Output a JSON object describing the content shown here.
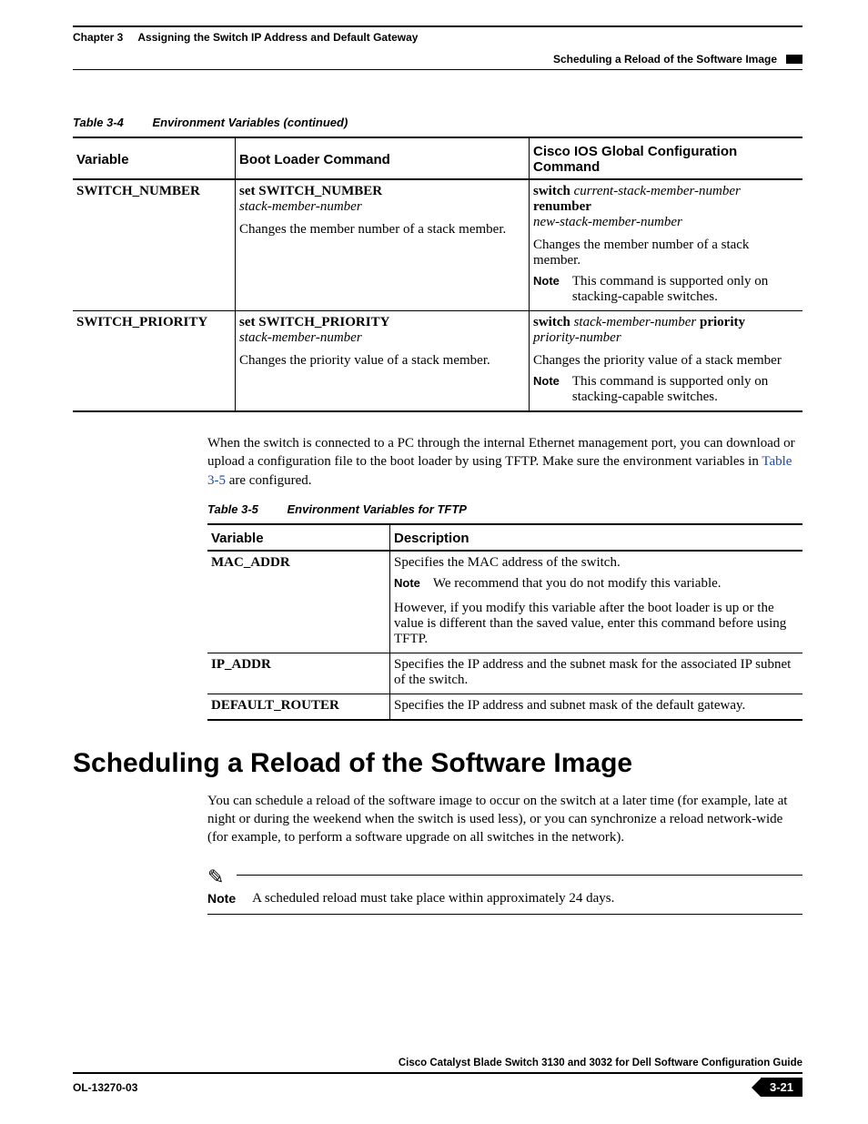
{
  "header": {
    "chapter_label": "Chapter 3",
    "chapter_title": "Assigning the Switch IP Address and Default Gateway",
    "breadcrumb": "Scheduling a Reload of the Software Image"
  },
  "table34": {
    "caption_num": "Table 3-4",
    "caption_title": "Environment Variables (continued)",
    "headers": [
      "Variable",
      "Boot Loader Command",
      "Cisco IOS Global Configuration Command"
    ],
    "rows": [
      {
        "variable": "SWITCH_NUMBER",
        "bl_cmd_bold": "set SWITCH_NUMBER",
        "bl_cmd_it": "stack-member-number",
        "bl_desc": "Changes the member number of a stack member.",
        "ios_parts": {
          "p1": "switch",
          "p2": "current-stack-member-number",
          "p3": "renumber",
          "p4": "new-stack-member-number"
        },
        "ios_desc": "Changes the member number of a stack member.",
        "note_label": "Note",
        "note_text": "This command is supported only on stacking-capable switches."
      },
      {
        "variable": "SWITCH_PRIORITY",
        "bl_cmd_bold": "set SWITCH_PRIORITY",
        "bl_cmd_it": "stack-member-number",
        "bl_desc": "Changes the priority value of a stack member.",
        "ios_parts": {
          "p1": "switch",
          "p2": "stack-member-number",
          "p3": "priority",
          "p4": "priority-number"
        },
        "ios_desc": "Changes the priority value of a stack member",
        "note_label": "Note",
        "note_text": "This command is supported only on stacking-capable switches."
      }
    ]
  },
  "para1": {
    "text_a": "When the switch is connected to a PC through the internal Ethernet management port, you can download or upload a configuration file to the boot loader by using TFTP. Make sure the environment variables in ",
    "link": "Table 3-5",
    "text_b": " are configured."
  },
  "table35": {
    "caption_num": "Table 3-5",
    "caption_title": "Environment Variables for TFTP",
    "headers": [
      "Variable",
      "Description"
    ],
    "rows": [
      {
        "variable": "MAC_ADDR",
        "desc1": "Specifies the MAC address of the switch.",
        "note_label": "Note",
        "note_text": "We recommend that you do not modify this variable.",
        "desc2": "However, if you modify this variable after the boot loader is up or the value is different than the saved value, enter this command before using TFTP."
      },
      {
        "variable": "IP_ADDR",
        "desc1": "Specifies the IP address and the subnet mask for the associated IP subnet of the switch."
      },
      {
        "variable": "DEFAULT_ROUTER",
        "desc1": "Specifies the IP address and subnet mask of the default gateway."
      }
    ]
  },
  "section": {
    "heading": "Scheduling a Reload of the Software Image",
    "para": "You can schedule a reload of the software image to occur on the switch at a later time (for example, late at night or during the weekend when the switch is used less), or you can synchronize a reload network-wide (for example, to perform a software upgrade on all switches in the network).",
    "note_label": "Note",
    "note_text": "A scheduled reload must take place within approximately 24 days."
  },
  "footer": {
    "guide": "Cisco Catalyst Blade Switch 3130 and 3032 for Dell Software Configuration Guide",
    "docnum": "OL-13270-03",
    "page": "3-21"
  }
}
